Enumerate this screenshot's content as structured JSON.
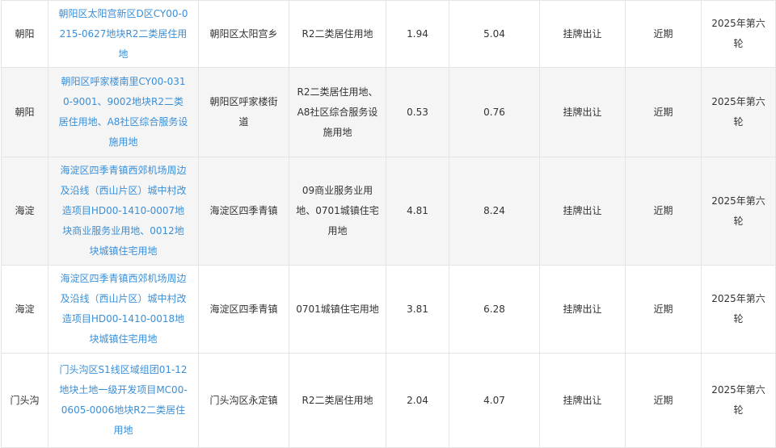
{
  "rows": [
    {
      "district": "朝阳",
      "name": "朝阳区太阳宫新区D区CY00-0215-0627地块R2二类居住用地",
      "location": "朝阳区太阳宫乡",
      "usage": "R2二类居住用地",
      "area": "1.94",
      "build_area": "5.04",
      "method": "挂牌出让",
      "timing": "近期",
      "round": "2025年第六轮"
    },
    {
      "district": "朝阳",
      "name": "朝阳区呼家楼南里CY00-0310-9001、9002地块R2二类居住用地、A8社区综合服务设施用地",
      "location": "朝阳区呼家楼街道",
      "usage": "R2二类居住用地、A8社区综合服务设施用地",
      "area": "0.53",
      "build_area": "0.76",
      "method": "挂牌出让",
      "timing": "近期",
      "round": "2025年第六轮"
    },
    {
      "district": "海淀",
      "name": "海淀区四季青镇西郊机场周边及沿线（西山片区）城中村改造项目HD00-1410-0007地块商业服务业用地、0012地块城镇住宅用地",
      "location": "海淀区四季青镇",
      "usage": "09商业服务业用地、0701城镇住宅用地",
      "area": "4.81",
      "build_area": "8.24",
      "method": "挂牌出让",
      "timing": "近期",
      "round": "2025年第六轮"
    },
    {
      "district": "海淀",
      "name": "海淀区四季青镇西郊机场周边及沿线（西山片区）城中村改造项目HD00-1410-0018地块城镇住宅用地",
      "location": "海淀区四季青镇",
      "usage": "0701城镇住宅用地",
      "area": "3.81",
      "build_area": "6.28",
      "method": "挂牌出让",
      "timing": "近期",
      "round": "2025年第六轮"
    },
    {
      "district": "门头沟",
      "name": "门头沟区S1线区域组团01-12地块土地一级开发项目MC00-0605-0006地块R2二类居住用地",
      "location": "门头沟区永定镇",
      "usage": "R2二类居住用地",
      "area": "2.04",
      "build_area": "4.07",
      "method": "挂牌出让",
      "timing": "近期",
      "round": "2025年第六轮"
    }
  ]
}
